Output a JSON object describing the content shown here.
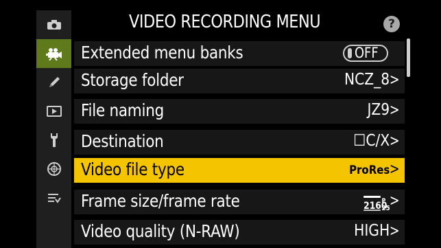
{
  "menu": {
    "title": "VIDEO RECORDING MENU",
    "help_label": "?"
  },
  "tabs": [
    {
      "icon": "camera-icon"
    },
    {
      "icon": "movie-camera-icon",
      "active": true
    },
    {
      "icon": "pencil-icon"
    },
    {
      "icon": "playback-icon"
    },
    {
      "icon": "wrench-icon"
    },
    {
      "icon": "network-icon"
    },
    {
      "icon": "my-menu-icon"
    }
  ],
  "items": [
    {
      "label": "Extended menu banks",
      "value": "OFF",
      "type": "toggle"
    },
    {
      "label": "Storage folder",
      "value": "NCZ_8"
    },
    {
      "label": "File naming",
      "value": "JZ9"
    },
    {
      "label": "Destination",
      "value": "☐C/X"
    },
    {
      "label": "Video file type",
      "value": "ProRes",
      "selected": true
    },
    {
      "label": "Frame size/frame rate",
      "value_icon": "2160p-25-icon",
      "value_text": "2160",
      "value_sub": "25"
    },
    {
      "label": "Video quality (N-RAW)",
      "value": "HIGH"
    }
  ],
  "chevron": ">",
  "colors": {
    "selected": "#f5c400",
    "active_tab": "#5e7a1b",
    "row_bg": "#171717"
  }
}
